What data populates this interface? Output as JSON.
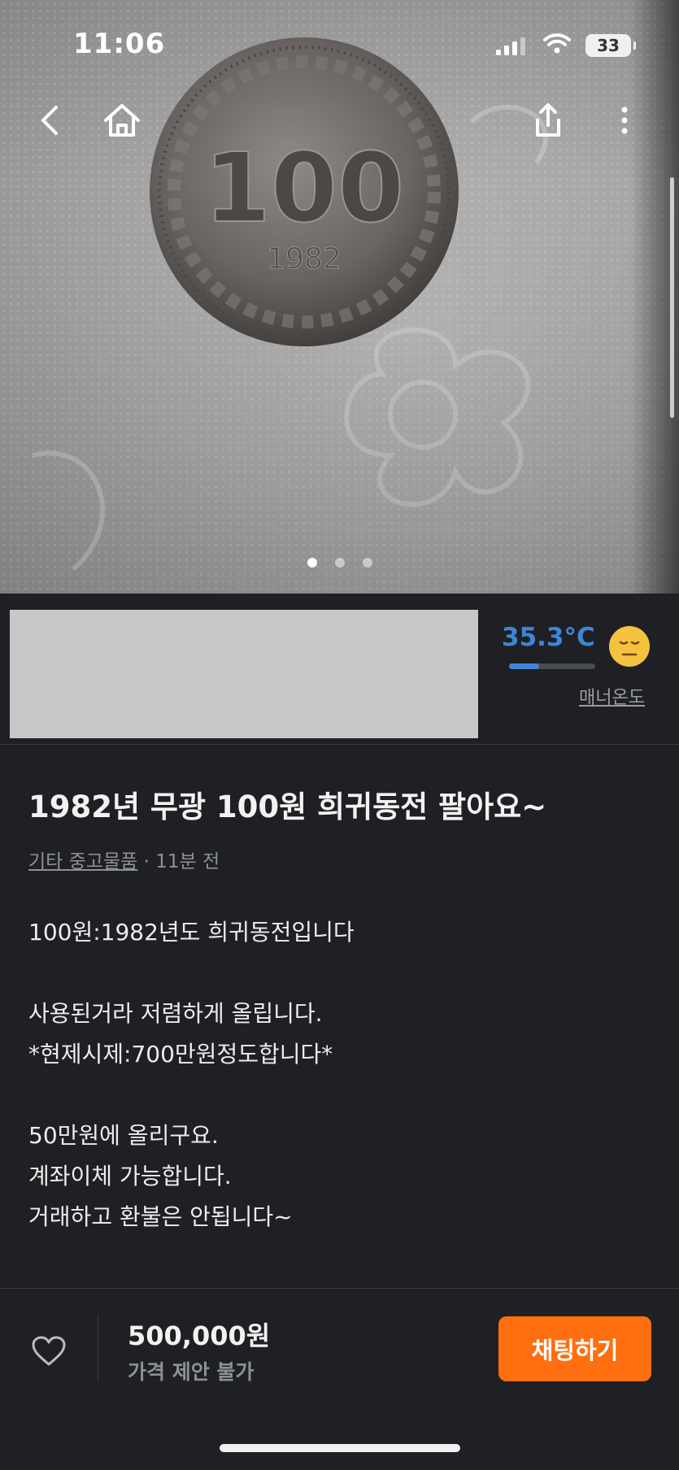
{
  "status_bar": {
    "time": "11:06",
    "battery": "33"
  },
  "photo": {
    "coin_face": "100",
    "coin_year": "1982",
    "page_count": 3,
    "active_page": 1
  },
  "seller": {
    "temperature": "35.3°C",
    "temperature_fill": 0.353,
    "manner_label": "매너온도"
  },
  "post": {
    "title": "1982년 무광 100원 희귀동전 팔아요~",
    "category": "기타 중고물품",
    "time_ago": "· 11분 전",
    "description": [
      "100원:1982년도 희귀동전입니다",
      "",
      "사용된거라 저렴하게 올립니다.",
      "*현제시제:700만원정도합니다*",
      "",
      "50만원에 올리구요.",
      "계좌이체 가능합니다.",
      "거래하고 환불은 안됩니다~"
    ]
  },
  "bottom_bar": {
    "price": "500,000원",
    "negotiation": "가격 제안 불가",
    "chat_button": "채팅하기"
  },
  "colors": {
    "accent": "#ff6f0f",
    "temperature": "#3f86d6",
    "background": "#1f2024"
  }
}
